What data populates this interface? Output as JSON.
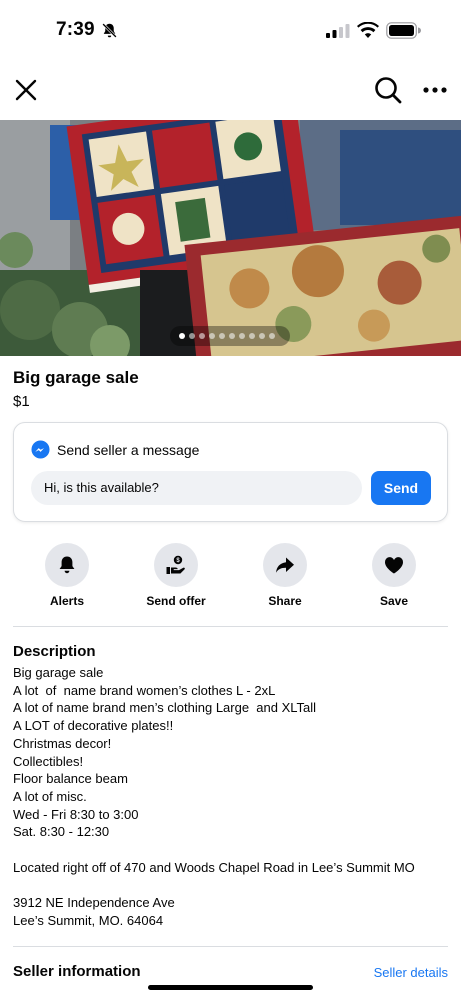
{
  "status_bar": {
    "time": "7:39",
    "icons": [
      "bell-slash-icon",
      "signal-icon",
      "wifi-icon",
      "battery-icon"
    ]
  },
  "nav": {
    "icons": [
      "close-icon",
      "search-icon",
      "more-icon"
    ]
  },
  "photo": {
    "description_icon": "listing-photo",
    "page_indicator": {
      "dot_count": 10,
      "active_index": 0
    }
  },
  "listing": {
    "title": "Big garage sale",
    "price": "$1"
  },
  "message_card": {
    "title": "Send seller a message",
    "input_value": "Hi, is this available?",
    "send_label": "Send",
    "accent_color": "#1877f2"
  },
  "actions": [
    {
      "label": "Alerts",
      "icon": "bell-icon"
    },
    {
      "label": "Send offer",
      "icon": "offer-icon"
    },
    {
      "label": "Share",
      "icon": "share-icon"
    },
    {
      "label": "Save",
      "icon": "heart-icon"
    }
  ],
  "description": {
    "title": "Description",
    "lines": [
      "Big garage sale",
      "A lot  of  name brand women’s clothes L - 2xL",
      "A lot of name brand men’s clothing Large  and XLTall",
      "A LOT of decorative plates!!",
      "Christmas decor!",
      "Collectibles!",
      "Floor balance beam",
      "A lot of misc.",
      "Wed - Fri 8:30 to 3:00",
      "Sat. 8:30 - 12:30",
      "",
      "Located right off of 470 and Woods Chapel Road in Lee’s Summit MO",
      "",
      "3912 NE Independence Ave",
      "Lee’s Summit, MO. 64064"
    ]
  },
  "seller": {
    "title": "Seller information",
    "details_link": "Seller details"
  }
}
